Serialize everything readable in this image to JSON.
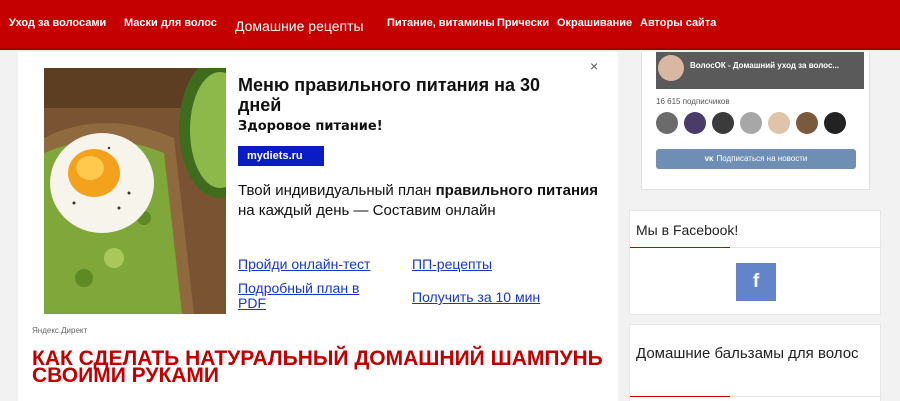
{
  "nav": {
    "items": [
      {
        "label": "Уход за волосами"
      },
      {
        "label": "Маски для волос"
      },
      {
        "label": "Домашние рецепты"
      },
      {
        "label": "Питание, витамины"
      },
      {
        "label": "Прически"
      },
      {
        "label": "Окрашивание"
      },
      {
        "label": "Авторы сайта"
      }
    ]
  },
  "ad": {
    "close": "×",
    "title": "Меню правильного питания на 30 дней",
    "subtitle": "Здоровое питание!",
    "domain": "mydiets.ru",
    "body_before": "Твой индивидуальный план ",
    "body_bold": "правильного питания",
    "body_after": " на каждый день — Составим онлайн",
    "links": [
      {
        "label": "Пройди онлайн-тест"
      },
      {
        "label": "ПП-рецепты"
      },
      {
        "label": "Подробный план в PDF"
      },
      {
        "label": "Получить за 10 мин"
      }
    ],
    "tag": "Яндекс.Директ"
  },
  "article": {
    "title": "Как сделать натуральный домашний шампунь своими руками"
  },
  "vk": {
    "name": "ВолосОК - Домашний уход за волос...",
    "subscribers": "16 615 подписчиков",
    "button": "Подписаться на новости",
    "button_icon": "vk-logo-icon"
  },
  "facebook": {
    "title": "Мы в Facebook!",
    "icon": "f"
  },
  "balm": {
    "title": "Домашние бальзамы для волос"
  },
  "colors": {
    "brand_red": "#c40000",
    "ad_domain_bg": "#0a1cc4",
    "link_blue": "#1a36c8",
    "facebook_blue": "#6384c9",
    "vk_button": "#6e8fb3"
  }
}
